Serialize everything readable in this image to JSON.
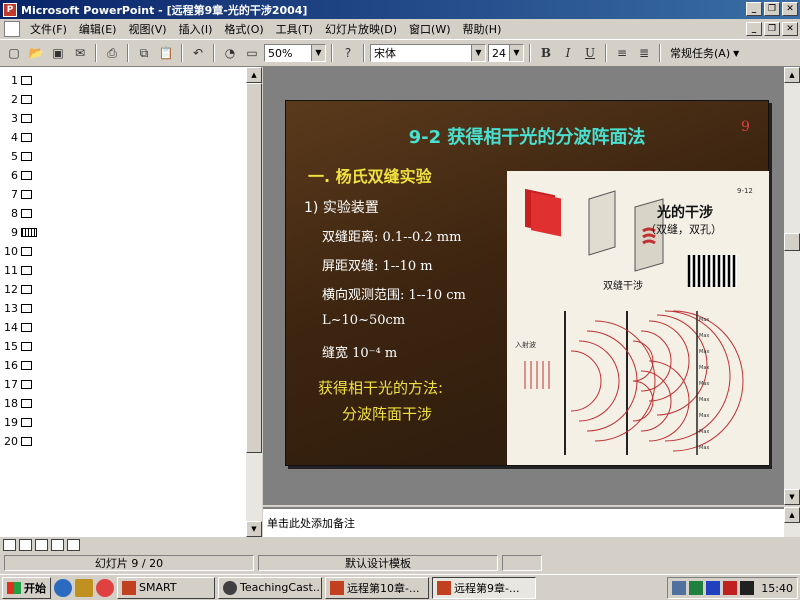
{
  "window": {
    "title": "Microsoft PowerPoint - [远程第9章-光的干涉2004]",
    "controls": [
      "_",
      "❐",
      "✕"
    ]
  },
  "menu": {
    "items": [
      "文件(F)",
      "编辑(E)",
      "视图(V)",
      "插入(I)",
      "格式(O)",
      "工具(T)",
      "幻灯片放映(D)",
      "窗口(W)",
      "帮助(H)"
    ],
    "doc_controls": [
      "_",
      "❐",
      "✕"
    ]
  },
  "toolbar": {
    "zoom": "50%",
    "font": "宋体",
    "size": "24",
    "bold": "B",
    "italic": "I",
    "underline": "U",
    "tasks": "常规任务(A)"
  },
  "outline": {
    "slides": [
      "1",
      "2",
      "3",
      "4",
      "5",
      "6",
      "7",
      "8",
      "9",
      "10",
      "11",
      "12",
      "13",
      "14",
      "15",
      "16",
      "17",
      "18",
      "19",
      "20"
    ]
  },
  "slide": {
    "title": "9-2  获得相干光的分波阵面法",
    "number": "9",
    "subtitle": "一. 杨氏双缝实验",
    "bullet": "1)  实验装置",
    "lines": [
      "双缝距离: 0.1--0.2 mm",
      "屏距双缝: 1--10 m",
      "横向观测范围: 1--10 cm",
      "L~10~50cm",
      "缝宽 10⁻⁴ m"
    ],
    "method": "获得相干光的方法:",
    "method_value": "分波阵面干涉",
    "figure": {
      "label_top": "光的干涉",
      "label_sub": "（双缝，双孔）",
      "label_fig": "双缝干涉",
      "ref": "9-12",
      "incident": "入射波"
    }
  },
  "notes": {
    "placeholder": "单击此处添加备注"
  },
  "status": {
    "slide": "幻灯片 9 / 20",
    "design": "默认设计模板"
  },
  "taskbar": {
    "start": "开始",
    "tasks": [
      "SMART",
      "TeachingCast...",
      "远程第10章-...",
      "远程第9章-..."
    ],
    "clock": "15:40"
  }
}
